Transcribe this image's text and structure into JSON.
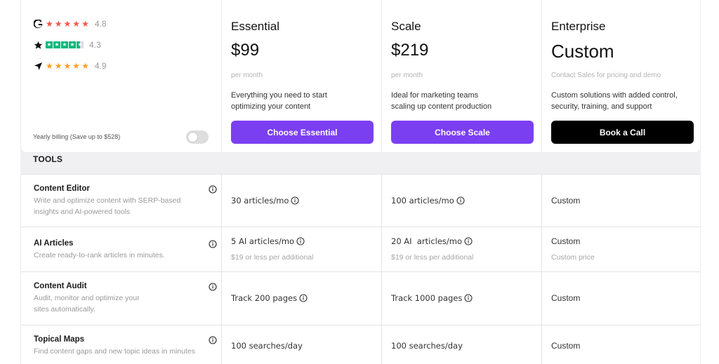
{
  "ratings": [
    {
      "source_icon": "g2-logo-icon",
      "stars": 5,
      "star_color": "#f1564b",
      "score": "4.8"
    },
    {
      "source_icon": "trustpilot-star-icon",
      "stars": 4.5,
      "star_color": "#00b67a",
      "score": "4.3"
    },
    {
      "source_icon": "capterra-arrow-icon",
      "stars": 5,
      "star_color": "#ff9d28",
      "score": "4.9"
    }
  ],
  "billing": {
    "label": "Yearly billing (Save up to $528)",
    "yearly_enabled": false
  },
  "plans": [
    {
      "name": "Essential",
      "price": "$99",
      "period": "per month",
      "description_lines": [
        "Everything you need to start",
        "optimizing your content"
      ],
      "cta": "Choose Essential",
      "cta_color": "#7b3ff2"
    },
    {
      "name": "Scale",
      "price": "$219",
      "period": "per month",
      "description_lines": [
        "Ideal for marketing teams",
        "scaling up content production"
      ],
      "cta": "Choose Scale",
      "cta_color": "#7b3ff2"
    },
    {
      "name": "Enterprise",
      "price": "Custom",
      "period": "Contact Sales for pricing and demo",
      "description_lines": [
        "Custom solutions with added control,",
        "security, training, and support"
      ],
      "cta": "Book a Call",
      "cta_color": "#000000"
    }
  ],
  "section": {
    "title": "TOOLS"
  },
  "features": [
    {
      "title": "Content Editor",
      "description_lines": [
        "Write and optimize content with SERP-based",
        "insights and AI-powered tools"
      ],
      "values": [
        {
          "text": "30 articles/mo",
          "info": true
        },
        {
          "text": "100 articles/mo",
          "info": true
        },
        {
          "text": "Custom",
          "info": false
        }
      ]
    },
    {
      "title": "AI Articles",
      "description_lines": [
        "Create ready-to-rank articles in minutes."
      ],
      "values": [
        {
          "text": "5 AI articles/mo",
          "info": true,
          "sub": "$19 or less per additional"
        },
        {
          "text": "20 AI  articles/mo",
          "info": true,
          "sub": "$19 or less per additional"
        },
        {
          "text": "Custom",
          "info": false,
          "sub": "Custom price"
        }
      ]
    },
    {
      "title": "Content Audit",
      "description_lines": [
        "Audit, monitor and optimize your",
        "sites automatically."
      ],
      "values": [
        {
          "text": "Track 200 pages",
          "info": true
        },
        {
          "text": "Track 1000 pages",
          "info": true
        },
        {
          "text": "Custom",
          "info": false
        }
      ]
    },
    {
      "title": "Topical Maps",
      "description_lines": [
        "Find content gaps and new topic ideas in minutes"
      ],
      "values": [
        {
          "text": "100 searches/day",
          "info": false
        },
        {
          "text": "100 searches/day",
          "info": false
        },
        {
          "text": "Custom",
          "info": false
        }
      ]
    }
  ]
}
